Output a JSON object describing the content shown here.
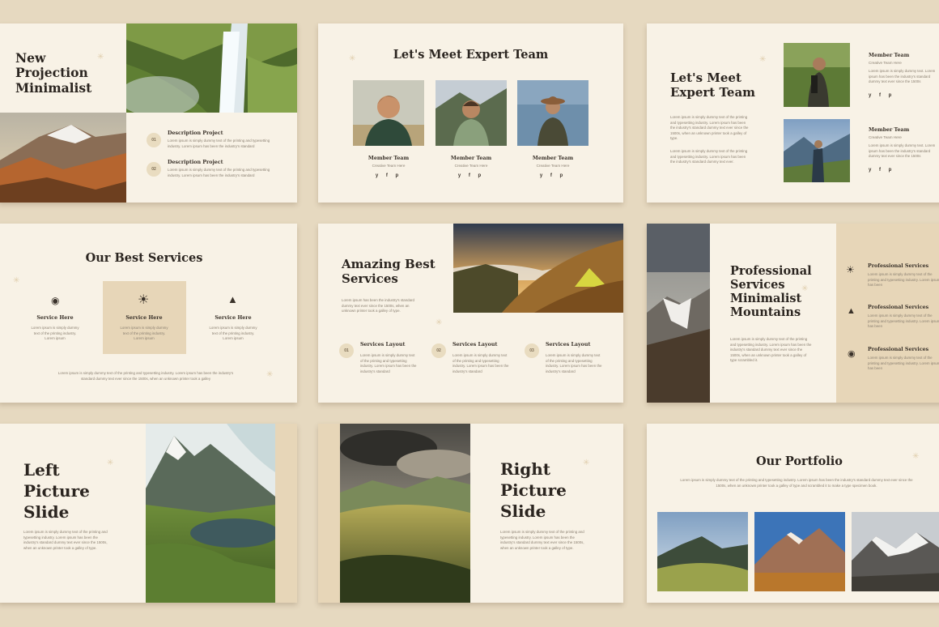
{
  "slides": {
    "s1": {
      "title": "New Projection Minimalist",
      "items": [
        {
          "num": "01",
          "label": "Description Project",
          "text": "Lorem ipsum is simply dummy text of the printing and typesetting industry. Lorem ipsum has been the industry's standard"
        },
        {
          "num": "02",
          "label": "Description Project",
          "text": "Lorem ipsum is simply dummy text of the printing and typesetting industry. Lorem ipsum has been the industry's standard"
        }
      ]
    },
    "s2": {
      "title": "Let's Meet Expert Team",
      "members": [
        {
          "name": "Member Team",
          "role": "Creative Team Here",
          "social": "y f p"
        },
        {
          "name": "Member Team",
          "role": "Creative Team Here",
          "social": "y f p"
        },
        {
          "name": "Member Team",
          "role": "Creative Team Here",
          "social": "y f p"
        }
      ]
    },
    "s3": {
      "title": "Let's Meet Expert Team",
      "para1": "Lorem ipsum is simply dummy text of the printing and typesetting industry. Lorem ipsum has been the industry's standard dummy text ever since the 1500s, when an unknown printer took a galley of type.",
      "para2": "Lorem ipsum is simply dummy text of the printing and typesetting industry. Lorem ipsum has been the industry's standard dummy text ever.",
      "members": [
        {
          "name": "Member Team",
          "role": "Creative Team Here",
          "text": "Lorem ipsum is simply dummy text. Lorem ipsum has been the industry's standard dummy text ever since the 1500s",
          "social": "y f p"
        },
        {
          "name": "Member Team",
          "role": "Creative Team Here",
          "text": "Lorem ipsum is simply dummy text. Lorem ipsum has been the industry's standard dummy text ever since the 1500s",
          "social": "y f p"
        }
      ]
    },
    "s4": {
      "title": "Our Best Services",
      "services": [
        {
          "label": "Service Here",
          "text": "Lorem ipsum is simply dummy text of the printing industry. Lorem ipsum"
        },
        {
          "label": "Service Here",
          "text": "Lorem ipsum is simply dummy text of the printing industry. Lorem ipsum"
        },
        {
          "label": "Service Here",
          "text": "Lorem ipsum is simply dummy text of the printing industry. Lorem ipsum"
        }
      ],
      "footer": "Lorem ipsum is simply dummy text of the printing and typesetting industry. Lorem ipsum has been the industry's standard dummy text ever since the 1500s, when an unknown printer took a galley"
    },
    "s5": {
      "title": "Amazing Best Services",
      "para": "Lorem ipsum has been the industry's standard dummy text ever since the 1500s, when an unknown printer took a galley of type.",
      "items": [
        {
          "num": "01",
          "label": "Services Layout",
          "text": "Lorem ipsum is simply dummy text of the printing and typesetting industry. Lorem ipsum has been the industry's standard"
        },
        {
          "num": "02",
          "label": "Services Layout",
          "text": "Lorem ipsum is simply dummy text of the printing and typesetting industry. Lorem ipsum has been the industry's standard"
        },
        {
          "num": "03",
          "label": "Services Layout",
          "text": "Lorem ipsum is simply dummy text of the printing and typesetting industry. Lorem ipsum has been the industry's standard"
        }
      ]
    },
    "s6": {
      "title": "Professional Services Minimalist Mountains",
      "para": "Lorem ipsum is simply dummy text of the printing and typesetting industry. Lorem ipsum has been the industry's standard dummy text ever since the 1500s, when an unknown printer took a galley of type scrambled it.",
      "items": [
        {
          "label": "Professional Services",
          "text": "Lorem ipsum is simply dummy text of the printing and typesetting industry. Lorem ipsum has been"
        },
        {
          "label": "Professional Services",
          "text": "Lorem ipsum is simply dummy text of the printing and typesetting industry. Lorem ipsum has been"
        },
        {
          "label": "Professional Services",
          "text": "Lorem ipsum is simply dummy text of the printing and typesetting industry. Lorem ipsum has been"
        }
      ]
    },
    "s7": {
      "title": "Left Picture Slide",
      "para": "Lorem ipsum is simply dummy text of the printing and typesetting industry. Lorem ipsum has been the industry's standard dummy text ever since the 1500s, when an unknown printer took a galley of type."
    },
    "s8": {
      "title": "Right Picture Slide",
      "para": "Lorem ipsum is simply dummy text of the printing and typesetting industry. Lorem ipsum has been the industry's standard dummy text ever since the 1500s, when an unknown printer took a galley of type."
    },
    "s9": {
      "title": "Our Portfolio",
      "para": "Lorem ipsum is simply dummy text of the printing and typesetting industry. Lorem ipsum has been the industry's standard dummy text ever since the 1500s, when an unknown printer took a galley of type and scrambled it to make a type specimen book."
    }
  },
  "colors": {
    "background": "#e6d9c0",
    "slide": "#f8f2e6",
    "accent": "#e7d6b8",
    "text": "#2b2520"
  }
}
